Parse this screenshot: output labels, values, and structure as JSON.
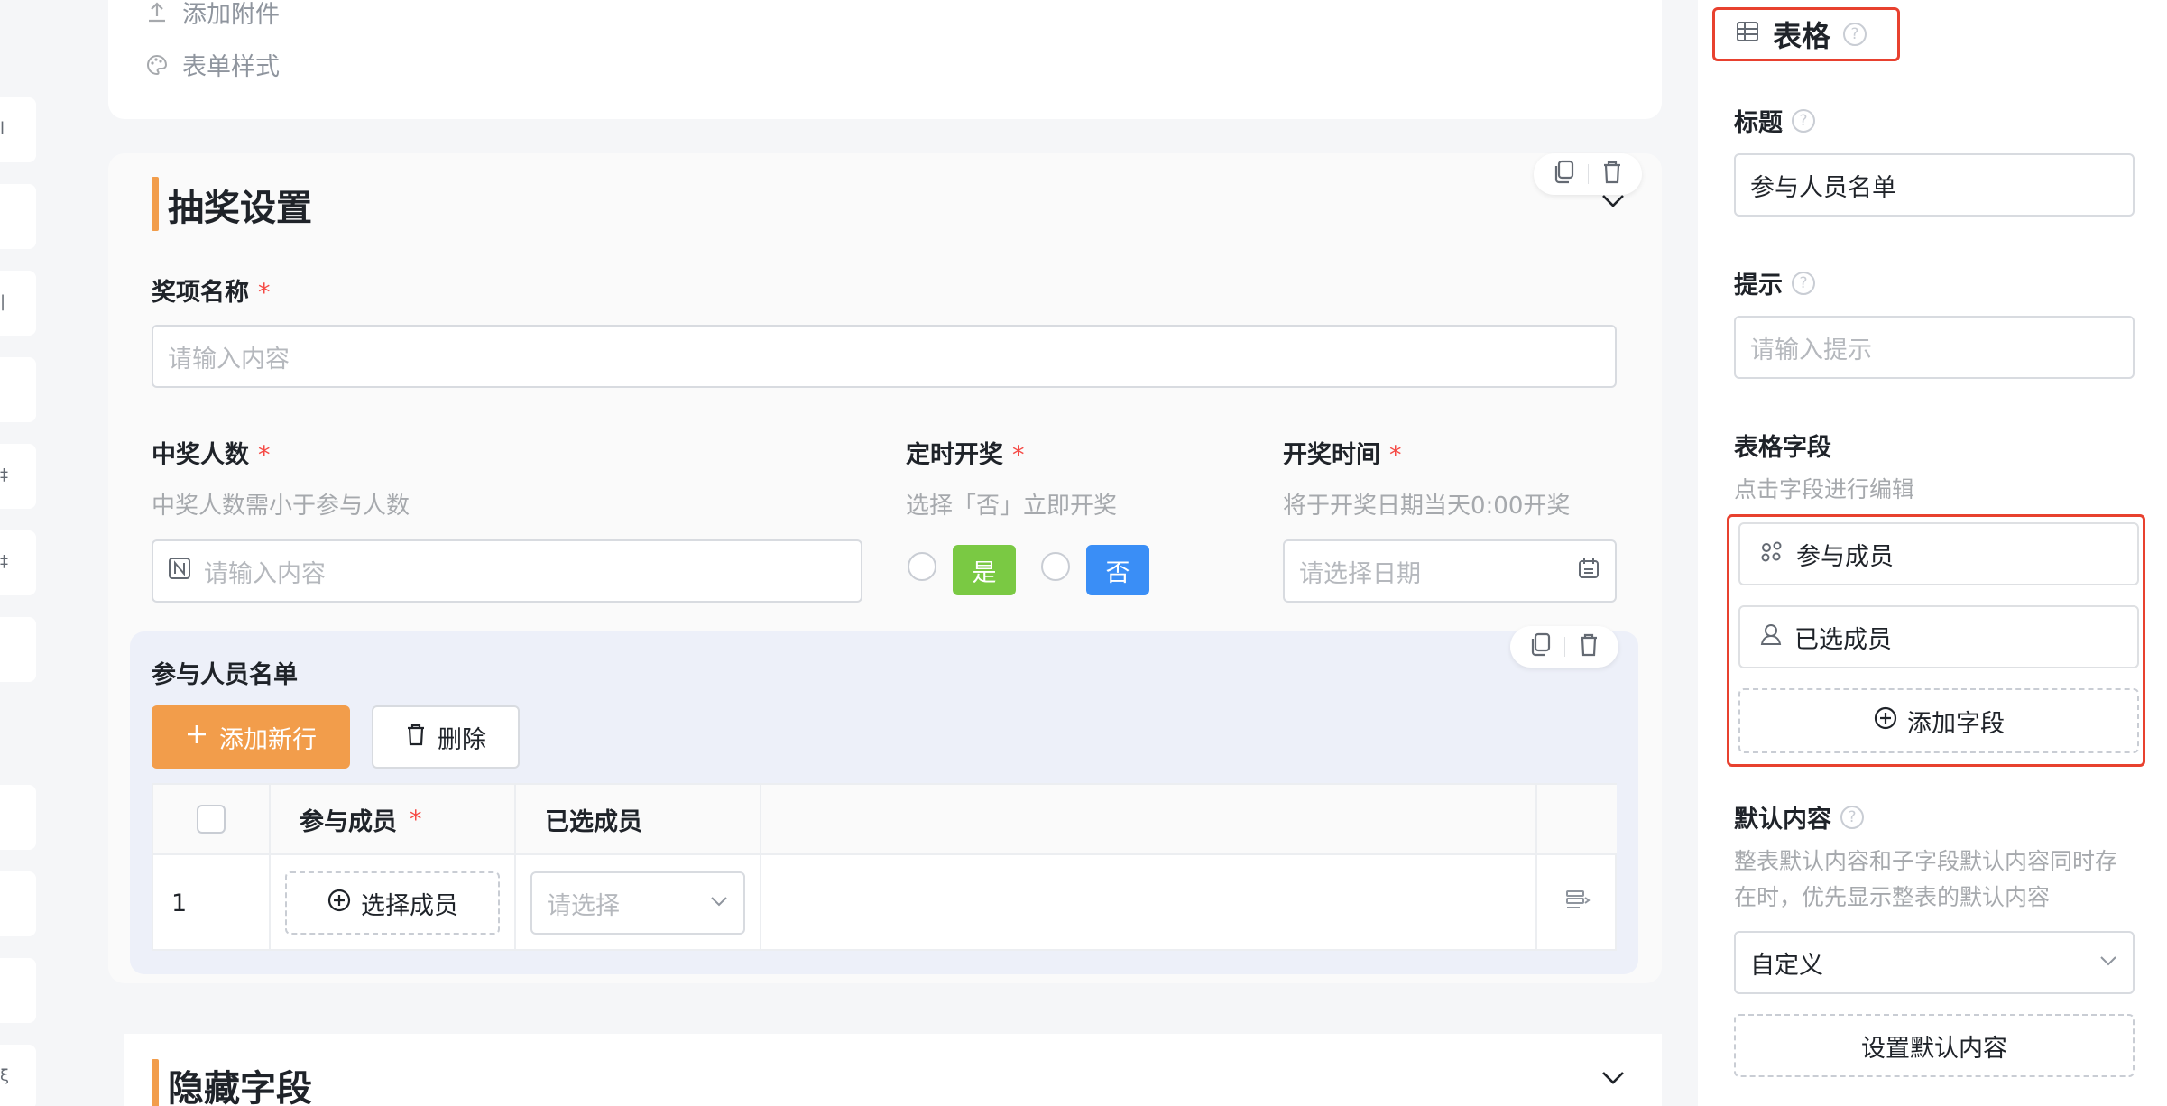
{
  "left_strip": {
    "items": [
      "l",
      "",
      "|",
      "",
      "‡",
      "‡",
      "",
      "",
      "",
      "",
      "ξ",
      ""
    ]
  },
  "top_card": {
    "attachment_label": "添加附件",
    "form_style_label": "表单样式"
  },
  "lottery_section": {
    "title": "抽奖设置",
    "prize_name": {
      "label": "奖项名称",
      "required_mark": "*",
      "placeholder": "请输入内容"
    },
    "winner_count": {
      "label": "中奖人数",
      "required_mark": "*",
      "hint": "中奖人数需小于参与人数",
      "placeholder": "请输入内容"
    },
    "timed_draw": {
      "label": "定时开奖",
      "required_mark": "*",
      "hint": "选择「否」立即开奖",
      "yes": "是",
      "no": "否"
    },
    "draw_time": {
      "label": "开奖时间",
      "required_mark": "*",
      "hint": "将于开奖日期当天0:00开奖",
      "placeholder": "请选择日期"
    }
  },
  "participants_table": {
    "title": "参与人员名单",
    "add_row": "添加新行",
    "delete": "删除",
    "columns": [
      "参与成员",
      "已选成员"
    ],
    "required_mark": "*",
    "rows": [
      {
        "index": "1",
        "select_member": "选择成员",
        "select_placeholder": "请选择"
      }
    ]
  },
  "hidden_section": {
    "title": "隐藏字段"
  },
  "right_panel": {
    "component_title": "表格",
    "title_field": {
      "label": "标题",
      "value": "参与人员名单"
    },
    "hint_field": {
      "label": "提示",
      "placeholder": "请输入提示"
    },
    "table_fields": {
      "label": "表格字段",
      "hint": "点击字段进行编辑",
      "items": [
        "参与成员",
        "已选成员"
      ],
      "add_field": "添加字段"
    },
    "default_content": {
      "label": "默认内容",
      "hint_line1": "整表默认内容和子字段默认内容同时存",
      "hint_line2": "在时，优先显示整表的默认内容",
      "select_value": "自定义",
      "set_button": "设置默认内容"
    }
  },
  "colors": {
    "accent_orange": "#f29d4b",
    "yes_green": "#7ac943",
    "no_blue": "#3a8ef6",
    "highlight_red": "#e8412f",
    "required_red": "#f54a45"
  }
}
